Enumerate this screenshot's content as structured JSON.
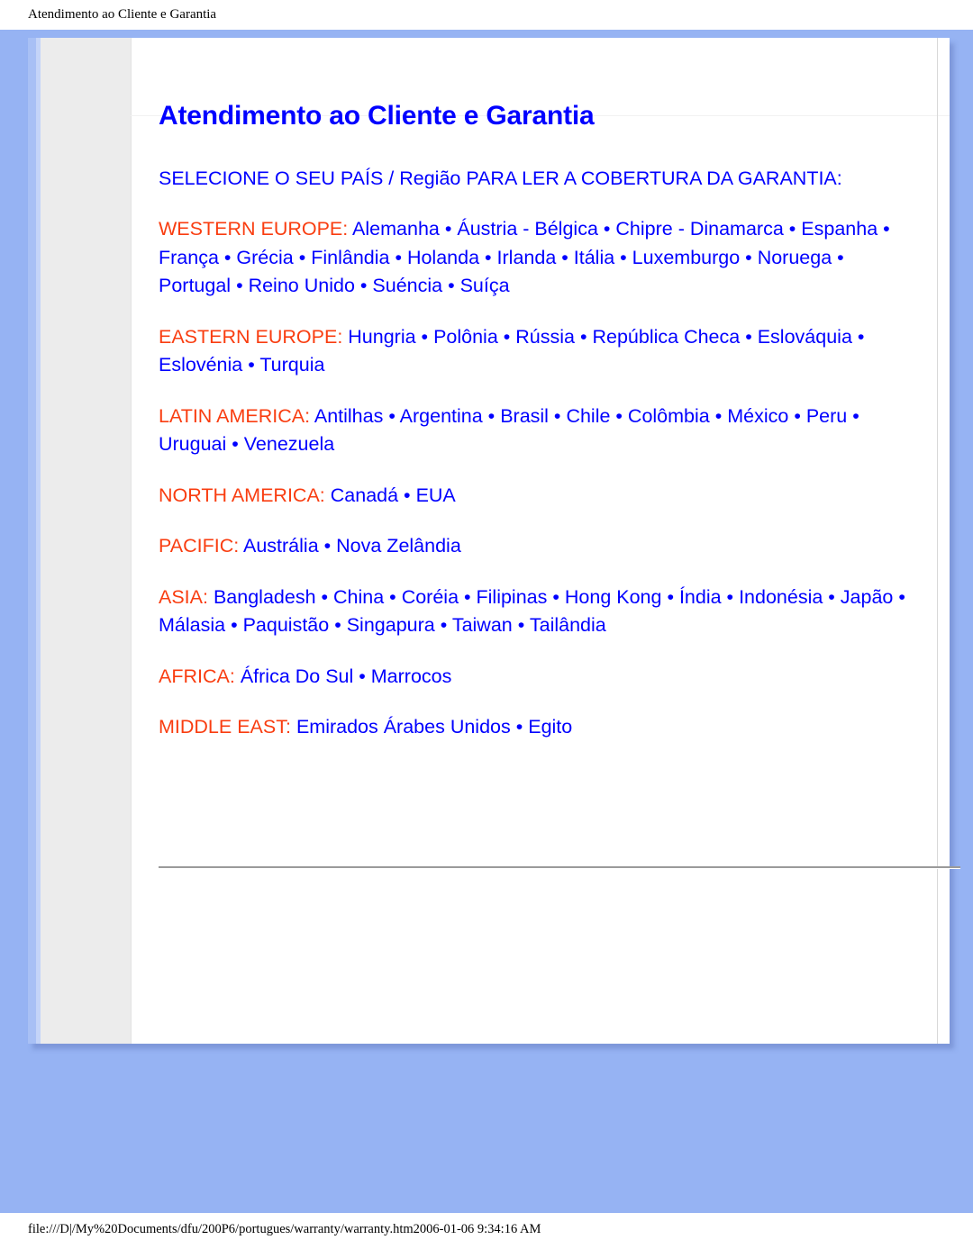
{
  "print_header": {
    "text": "Atendimento ao Cliente e Garantia"
  },
  "print_footer": {
    "text": "file:///D|/My%20Documents/dfu/200P6/portugues/warranty/warranty.htm2006-01-06 9:34:16 AM"
  },
  "colors": {
    "page_background": "#96b3f3",
    "panel_background": "#ececec",
    "sheet_background": "#ffffff",
    "link": "#0000ff",
    "title": "#0000ff",
    "region_label": "#f93d10",
    "rule": "#9a9a9a"
  },
  "document": {
    "title": "Atendimento ao Cliente e Garantia",
    "subtitle": "SELECIONE O SEU PAÍS / Região PARA LER A COBERTURA DA GARANTIA:",
    "separator": " • ",
    "regions": [
      {
        "label": "WESTERN EUROPE:",
        "countries": [
          "Alemanha",
          "Áustria - Bélgica",
          "Chipre - Dinamarca",
          "Espanha",
          "França",
          "Grécia",
          "Finlândia",
          "Holanda",
          "Irlanda",
          "Itália",
          "Luxemburgo",
          "Noruega",
          "Portugal",
          "Reino Unido",
          "Suéncia",
          "Suíça"
        ]
      },
      {
        "label": "EASTERN EUROPE:",
        "countries": [
          "Hungria",
          "Polônia",
          "Rússia",
          "República Checa",
          "Eslováquia",
          "Eslovénia",
          "Turquia"
        ]
      },
      {
        "label": "LATIN AMERICA:",
        "countries": [
          "Antilhas",
          "Argentina",
          "Brasil",
          "Chile",
          "Colômbia",
          "México",
          "Peru",
          "Uruguai",
          "Venezuela"
        ]
      },
      {
        "label": "NORTH AMERICA:",
        "countries": [
          "Canadá",
          "EUA"
        ]
      },
      {
        "label": "PACIFIC:",
        "countries": [
          "Austrália",
          "Nova Zelândia"
        ]
      },
      {
        "label": "ASIA:",
        "countries": [
          "Bangladesh",
          "China",
          "Coréia",
          "Filipinas",
          "Hong Kong",
          "Índia",
          "Indonésia",
          "Japão",
          "Málasia",
          "Paquistão",
          "Singapura",
          "Taiwan",
          "Tailândia"
        ]
      },
      {
        "label": "AFRICA:",
        "countries": [
          "África Do Sul",
          "Marrocos"
        ]
      },
      {
        "label": "MIDDLE EAST:",
        "countries": [
          "Emirados Árabes Unidos",
          "Egito"
        ]
      }
    ]
  }
}
